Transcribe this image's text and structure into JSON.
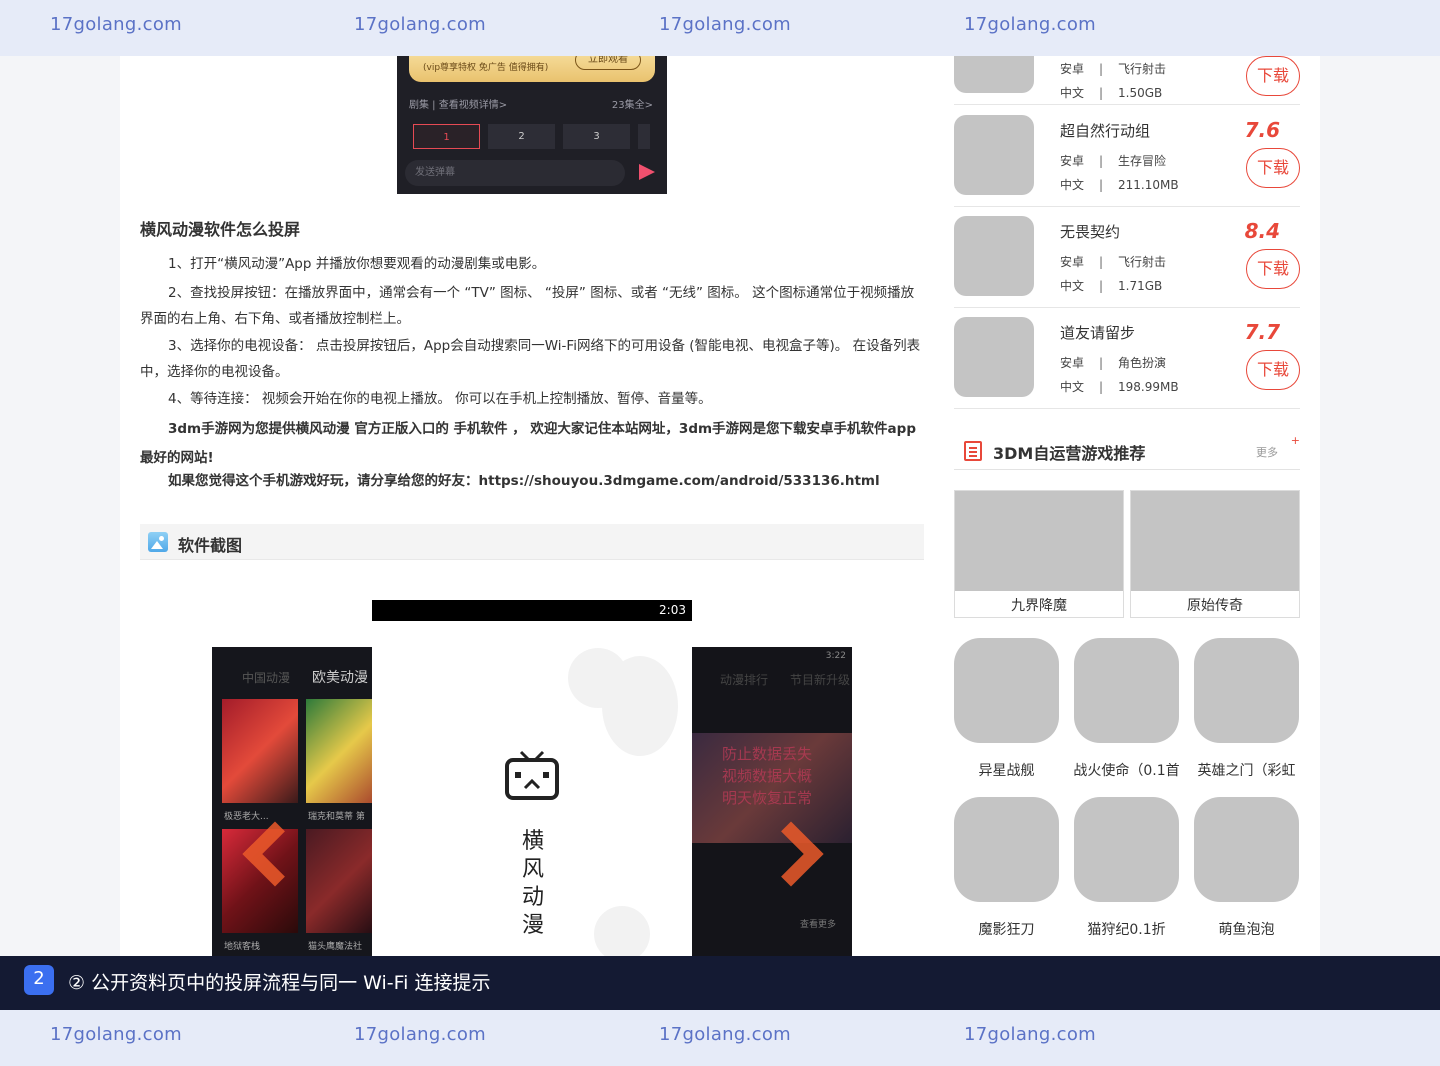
{
  "watermark": {
    "text": "17golang.com"
  },
  "video": {
    "vip_text": "(vip尊享特权 免广告 值得拥有)",
    "vip_button": "立即观看",
    "episodes_title": "剧集 | 查看视频详情>",
    "episodes_count": "23集全>",
    "episodes": [
      "1",
      "2",
      "3"
    ],
    "danmu_placeholder": "发送弹幕"
  },
  "article": {
    "heading": "横风动漫软件怎么投屏",
    "paragraphs": [
      "1、打开“横风动漫”App 并播放你想要观看的动漫剧集或电影。",
      "2、查找投屏按钮：在播放界面中，通常会有一个 “TV” 图标、 “投屏” 图标、或者 “无线” 图标。 这个图标通常位于视频播放界面的右上角、右下角、或者播放控制栏上。",
      "3、选择你的电视设备： 点击投屏按钮后，App会自动搜索同一Wi-Fi网络下的可用设备 (智能电视、电视盒子等)。 在设备列表中，选择你的电视设备。",
      "4、等待连接： 视频会开始在你的电视上播放。 你可以在手机上控制播放、暂停、音量等。",
      "3dm手游网为您提供横风动漫 官方正版入口的 手机软件 ， 欢迎大家记住本站网址，3dm手游网是您下载安卓手机软件app最好的网站!",
      "如果您觉得这个手机游戏好玩，请分享给您的好友：https://shouyou.3dmgame.com/android/533136.html"
    ],
    "screenshot_heading": "软件截图"
  },
  "gallery": {
    "status_time": "2:03",
    "right_status_time": "3:22",
    "splash_text": [
      "横",
      "风",
      "动",
      "漫"
    ],
    "left_tabs": [
      "中国动漫",
      "欧美动漫"
    ],
    "left_labels": [
      "极恶老大...",
      "瑞克和莫蒂 第",
      "地狱客栈",
      "猫头鹰魔法社"
    ],
    "right_tabs": [
      "动漫排行",
      "节目新升级"
    ],
    "right_notice": [
      "防止数据丢失",
      "视频数据大概",
      "明天恢复正常"
    ],
    "right_more": "查看更多"
  },
  "sidebar": {
    "games": [
      {
        "name": "",
        "score": "",
        "platform": "安卓",
        "genre": "飞行射击",
        "lang": "中文",
        "size": "1.50GB",
        "download": "下载"
      },
      {
        "name": "超自然行动组",
        "score": "7.6",
        "platform": "安卓",
        "genre": "生存冒险",
        "lang": "中文",
        "size": "211.10MB",
        "download": "下载"
      },
      {
        "name": "无畏契约",
        "score": "8.4",
        "platform": "安卓",
        "genre": "飞行射击",
        "lang": "中文",
        "size": "1.71GB",
        "download": "下载"
      },
      {
        "name": "道友请留步",
        "score": "7.7",
        "platform": "安卓",
        "genre": "角色扮演",
        "lang": "中文",
        "size": "198.99MB",
        "download": "下载"
      }
    ],
    "rec_title": "3DM自运营游戏推荐",
    "rec_more": "更多",
    "rec_plus": "+",
    "big_cards": [
      "九界降魔",
      "原始传奇"
    ],
    "small_cards": [
      "异星战舰",
      "战火使命（0.1首",
      "英雄之门（彩虹",
      "魔影狂刀",
      "猫狩纪0.1折",
      "萌鱼泡泡"
    ]
  },
  "caption": {
    "badge": "2",
    "text": "② 公开资料页中的投屏流程与同一 Wi-Fi 连接提示"
  }
}
